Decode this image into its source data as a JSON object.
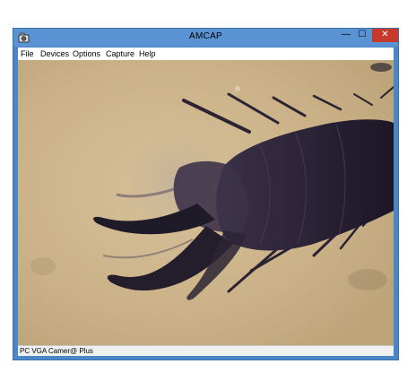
{
  "window": {
    "title": "AMCAP",
    "controls": {
      "minimize": "—",
      "maximize": "☐",
      "close": "✕"
    }
  },
  "menu": {
    "items": [
      {
        "label": "File"
      },
      {
        "label": "Devices"
      },
      {
        "label": "Options"
      },
      {
        "label": "Capture"
      },
      {
        "label": "Help"
      }
    ]
  },
  "preview": {
    "subject": "microscope image of insect claw",
    "background_color": "#cdb48b",
    "subject_color": "#2e2438"
  },
  "status": {
    "text": "PC VGA Camer@ Plus"
  },
  "icons": {
    "app": "camera-icon"
  }
}
